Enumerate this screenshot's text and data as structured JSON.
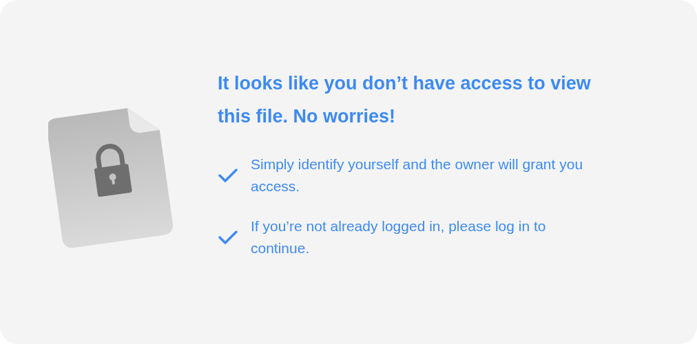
{
  "heading": "It looks like you don’t have access to view this file. No worries!",
  "points": [
    "Simply identify yourself and the owner will grant you access.",
    "If you’re not already logged in, please log in to continue."
  ]
}
